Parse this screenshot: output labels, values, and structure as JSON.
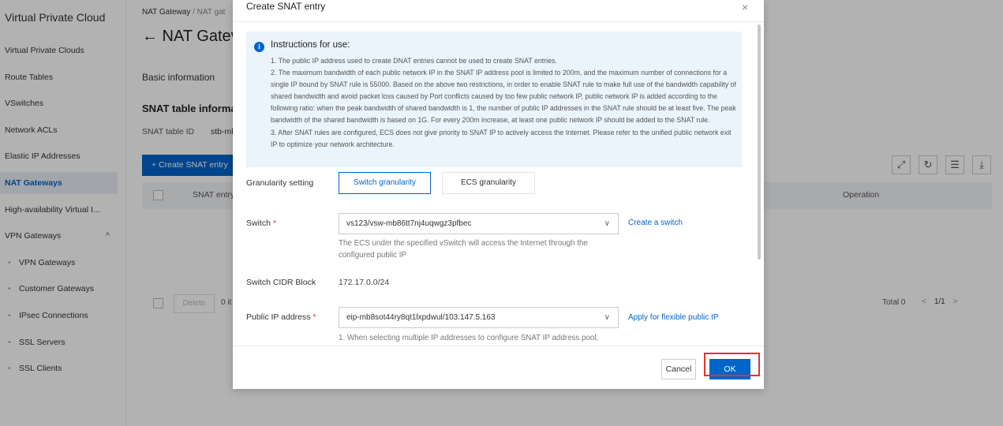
{
  "sidebar": {
    "title": "Virtual Private Cloud",
    "items": [
      {
        "label": "Virtual Private Clouds"
      },
      {
        "label": "Route Tables"
      },
      {
        "label": "VSwitches"
      },
      {
        "label": "Network ACLs"
      },
      {
        "label": "Elastic IP Addresses"
      },
      {
        "label": "NAT Gateways",
        "active": true
      },
      {
        "label": "High-availability Virtual I..."
      },
      {
        "label": "VPN Gateways",
        "expanded": true
      },
      {
        "label": "VPN Gateways",
        "sub": true
      },
      {
        "label": "Customer Gateways",
        "sub": true
      },
      {
        "label": "IPsec Connections",
        "sub": true
      },
      {
        "label": "SSL Servers",
        "sub": true
      },
      {
        "label": "SSL Clients",
        "sub": true
      }
    ]
  },
  "page": {
    "breadcrumb": [
      "NAT Gateway",
      "NAT gat"
    ],
    "title": "← NAT Gatev",
    "tab_basic": "Basic information",
    "snat_title": "SNAT table informat",
    "snat_id_label": "SNAT table ID",
    "snat_id_value": "stb-mk",
    "create_button": "+ Create SNAT entry",
    "table_col_snat": "SNAT entry",
    "table_col_operation": "Operation",
    "delete_button": "Delete",
    "items_text": "0 it",
    "total_text": "Total 0",
    "pager": {
      "prev": "<",
      "page": "1/1",
      "next": ">"
    }
  },
  "toolbar_icons": [
    "expand-icon",
    "refresh-icon",
    "columns-icon",
    "download-icon"
  ],
  "dialog": {
    "title": "Create SNAT entry",
    "close": "×",
    "instructions": {
      "title": "Instructions for use:",
      "lines": [
        "1. The public IP address used to create DNAT entries cannot be used to create SNAT entries.",
        "2. The maximum bandwidth of each public network IP in the SNAT IP address pool is limited to 200m, and the maximum number of connections for a single IP bound by SNAT rule is 55000. Based on the above two restrictions, in order to enable SNAT rule to make full use of the bandwidth capability of shared bandwidth and avoid packet loss caused by Port conflicts caused by too few public network IP, public network IP is added according to the following ratio: when the peak bandwidth of shared bandwidth is 1, the number of public IP addresses in the SNAT rule should be at least five. The peak bandwidth of the shared bandwidth is based on 1G. For every 200m increase, at least one public network IP should be added to the SNAT rule.",
        "3. After SNAT rules are configured, ECS does not give priority to SNAT IP to actively access the Internet. Please refer to the unified public network exit IP to optimize your network architecture."
      ]
    },
    "granularity": {
      "label": "Granularity setting",
      "options": [
        "Switch granularity",
        "ECS granularity"
      ],
      "selected": "Switch granularity"
    },
    "switch": {
      "label": "Switch",
      "required_mark": "*",
      "value": "vs123/vsw-mb86tt7nj4uqwgz3pfbec",
      "link": "Create a switch",
      "hint": "The ECS under the specified vSwitch will access the Internet through the configured public IP"
    },
    "cidr": {
      "label": "Switch CIDR Block",
      "value": "172.17.0.0/24"
    },
    "public_ip": {
      "label": "Public IP address",
      "required_mark": "*",
      "value": "eip-mb8sot44ry8qt1lxpdwul/103.147.5.163",
      "link": "Apply for flexible public IP",
      "hint": "1. When selecting multiple IP addresses to configure SNAT IP address pool,"
    },
    "cancel": "Cancel",
    "ok": "OK"
  },
  "colors": {
    "primary": "#0064c8",
    "highlight": "#e0322f",
    "info_bg": "#eaf4fc"
  }
}
